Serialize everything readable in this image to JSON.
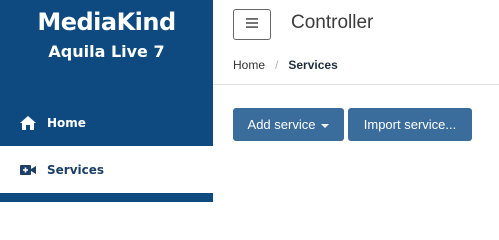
{
  "brand": {
    "logo_text": "MediaKind",
    "product": "Aquila Live 7"
  },
  "sidebar": {
    "items": [
      {
        "label": "Home",
        "icon": "home-icon"
      },
      {
        "label": "Services",
        "icon": "video-camera-icon",
        "active": true
      }
    ]
  },
  "header": {
    "title": "Controller",
    "menu_icon": "hamburger-icon"
  },
  "breadcrumb": {
    "items": [
      "Home",
      "Services"
    ],
    "separator": "/"
  },
  "actions": {
    "add_service_label": "Add service",
    "import_service_label": "Import service..."
  },
  "colors": {
    "sidebar_bg": "#0e4a80",
    "button_bg": "#3b6d9c",
    "active_item_bg": "#ffffff",
    "active_item_text": "#1c3f66"
  }
}
